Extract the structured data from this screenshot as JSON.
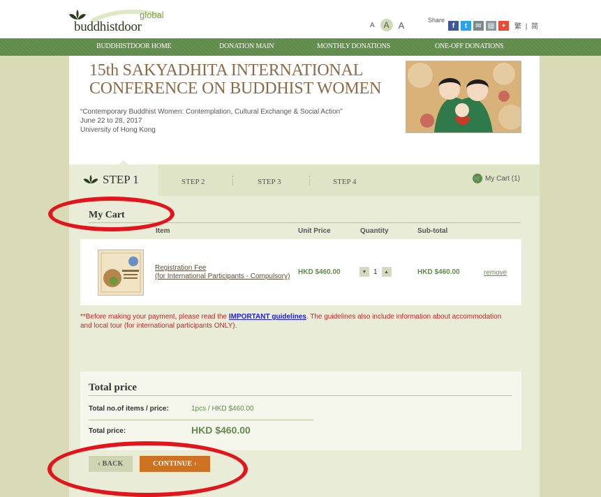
{
  "header": {
    "logo_text": "buddhistdoor",
    "logo_global": "global",
    "font_sizes": [
      "A",
      "A",
      "A"
    ],
    "share_label": "Share",
    "share_icons": [
      "facebook-icon",
      "twitter-icon",
      "email-icon",
      "print-icon",
      "plus-icon"
    ],
    "lang_trad": "繁",
    "lang_sep": "|",
    "lang_simp": "简"
  },
  "nav": {
    "items": [
      "BUDDHISTDOOR HOME",
      "DONATION MAIN",
      "MONTHLY DONATIONS",
      "ONE-OFF DONATIONS"
    ]
  },
  "event": {
    "title_line1": "15th SAKYADHITA INTERNATIONAL",
    "title_line2": "CONFERENCE ON BUDDHIST WOMEN",
    "theme": "“Contemporary Buddhist Women: Contemplation, Cultural Exchange & Social Action”",
    "dates": "June 22 to 28, 2017",
    "venue": "University of Hong Kong"
  },
  "steps": {
    "items": [
      "STEP 1",
      "STEP 2",
      "STEP 3",
      "STEP 4"
    ],
    "active": "STEP 1",
    "cart_label": "My Cart (1)"
  },
  "cart": {
    "title": "My Cart",
    "columns": [
      "Item",
      "Unit Price",
      "Quantity",
      "Sub-total"
    ],
    "items": [
      {
        "name_line1": "Registration Fee",
        "name_line2": "(for International Participants - Compulsory)",
        "unit_price": "HKD $460.00",
        "quantity": "1",
        "subtotal": "HKD $460.00",
        "remove_label": "remove"
      }
    ]
  },
  "notice": {
    "prefix": "**Before making your payment, please read the ",
    "link": "IMPORTANT guidelines",
    "suffix": ". The guidelines also include information about accommodation and local tour (for international participants ONLY)."
  },
  "total": {
    "title": "Total price",
    "items_label": "Total no.of items / price:",
    "items_value": "1pcs / HKD $460.00",
    "price_label": "Total price:",
    "price_value": "HKD $460.00"
  },
  "buttons": {
    "back": "‹ BACK",
    "continue": "CONTINUE ›"
  },
  "colors": {
    "nav_green": "#5f8a4a",
    "accent_orange": "#cc7222",
    "annotation_red": "#e3141c",
    "title_brown": "#8c6a48"
  }
}
